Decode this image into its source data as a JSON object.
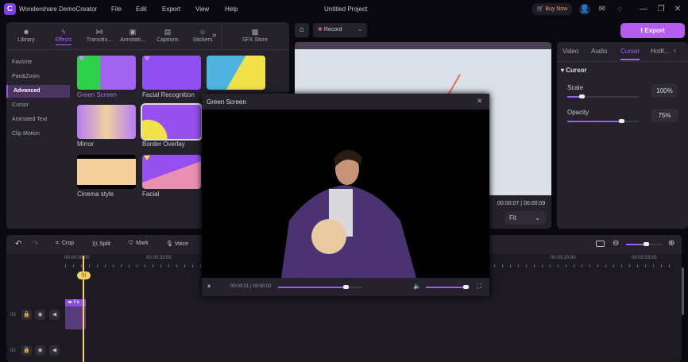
{
  "app": {
    "name": "Wondershare DemoCreator",
    "project_title": "Untitled Project",
    "menu": [
      "File",
      "Edit",
      "Export",
      "View",
      "Help"
    ],
    "buy_now": "Buy Now",
    "export": "Export"
  },
  "library_tabs": [
    {
      "label": "Library",
      "icon": "library-icon"
    },
    {
      "label": "Effects",
      "icon": "effects-icon"
    },
    {
      "label": "Transitio...",
      "icon": "transition-icon"
    },
    {
      "label": "Annotati...",
      "icon": "annotation-icon"
    },
    {
      "label": "Captions",
      "icon": "captions-icon"
    },
    {
      "label": "Stickers",
      "icon": "stickers-icon"
    },
    {
      "label": "SFX Store",
      "icon": "sfx-store-icon"
    }
  ],
  "categories": [
    "Favorite",
    "Pan&Zoom",
    "Advanced",
    "Cursor",
    "Animated Text",
    "Clip Motion"
  ],
  "active_category": "Advanced",
  "effects": [
    "Green Screen",
    "Facial Recognition",
    "Mirror",
    "Border Overlay",
    "Cinema style",
    "Facial"
  ],
  "record": "Record",
  "preview": {
    "current": "00:00:07",
    "total": "00:00:09",
    "fit": "Fit"
  },
  "right_panel": {
    "tabs": [
      "Video",
      "Audio",
      "Cursor",
      "HotK..."
    ],
    "active_tab": "Cursor",
    "section": "Cursor",
    "scale_label": "Scale",
    "scale_value": "100%",
    "scale_fraction": 0.2,
    "opacity_label": "Opacity",
    "opacity_value": "75%",
    "opacity_fraction": 0.75
  },
  "timeline": {
    "tools": [
      "Crop",
      "Split",
      "Mark",
      "Voice"
    ],
    "ruler": [
      "00:00:00:00",
      "00:00:33:05",
      "00:03:20:00",
      "00:03:53:05"
    ],
    "tracks": [
      "03",
      "02"
    ],
    "clip_label": "Fa",
    "zoom_fraction": 0.55
  },
  "dialog": {
    "title": "Green Screen",
    "time": "00:00:01 | 00:00:02",
    "progress": 0.8,
    "volume": 0.9
  },
  "colors": {
    "accent": "#a05cf5",
    "playhead": "#f4d35e"
  }
}
